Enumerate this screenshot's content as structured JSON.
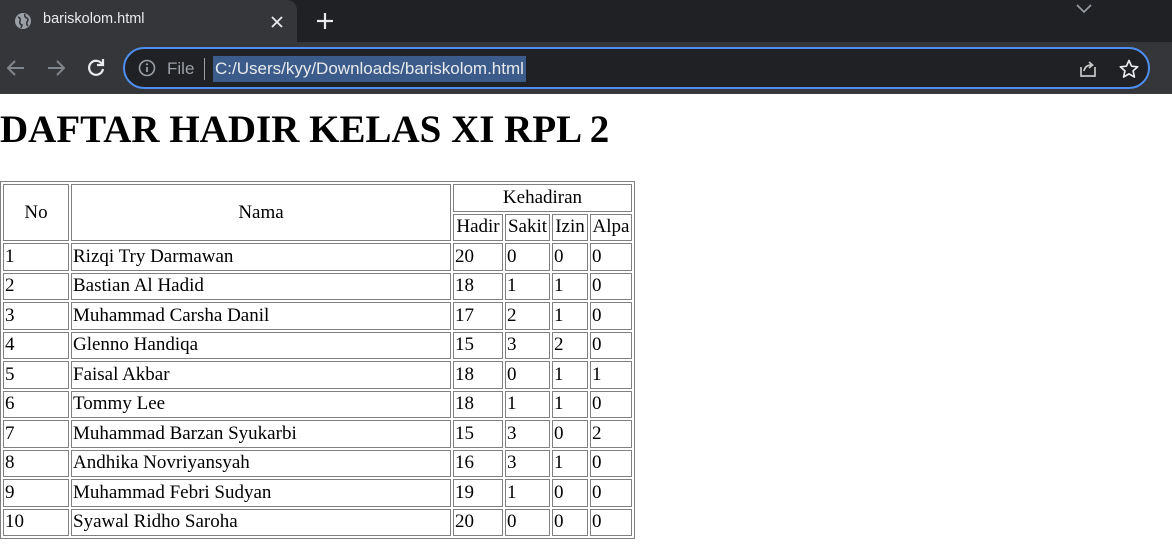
{
  "browser": {
    "tab_title": "bariskolom.html",
    "omnibox": {
      "scheme_label": "File",
      "url": "C:/Users/kyy/Downloads/bariskolom.html"
    },
    "icons": [
      "globe-icon",
      "close-icon",
      "plus-icon",
      "chevron-down-icon",
      "back-arrow-icon",
      "forward-arrow-icon",
      "reload-icon",
      "info-icon",
      "share-icon",
      "star-icon",
      "side-panel-icon"
    ],
    "colors": {
      "tabbar": "#202124",
      "toolbar": "#35363a",
      "focus_ring": "#4d8ff0",
      "url_selection": "#3b5b8a"
    }
  },
  "page": {
    "heading": "DAFTAR HADIR KELAS XI RPL 2",
    "table": {
      "headers": {
        "no": "No",
        "nama": "Nama",
        "kehadiran": "Kehadiran",
        "sub": [
          "Hadir",
          "Sakit",
          "Izin",
          "Alpa"
        ]
      },
      "rows": [
        [
          "1",
          "Rizqi Try Darmawan",
          "20",
          "0",
          "0",
          "0"
        ],
        [
          "2",
          "Bastian Al Hadid",
          "18",
          "1",
          "1",
          "0"
        ],
        [
          "3",
          "Muhammad Carsha Danil",
          "17",
          "2",
          "1",
          "0"
        ],
        [
          "4",
          "Glenno Handiqa",
          "15",
          "3",
          "2",
          "0"
        ],
        [
          "5",
          "Faisal Akbar",
          "18",
          "0",
          "1",
          "1"
        ],
        [
          "6",
          "Tommy Lee",
          "18",
          "1",
          "1",
          "0"
        ],
        [
          "7",
          "Muhammad Barzan Syukarbi",
          "15",
          "3",
          "0",
          "2"
        ],
        [
          "8",
          "Andhika Novriyansyah",
          "16",
          "3",
          "1",
          "0"
        ],
        [
          "9",
          "Muhammad Febri Sudyan",
          "19",
          "1",
          "0",
          "0"
        ],
        [
          "10",
          "Syawal Ridho Saroha",
          "20",
          "0",
          "0",
          "0"
        ]
      ]
    }
  }
}
